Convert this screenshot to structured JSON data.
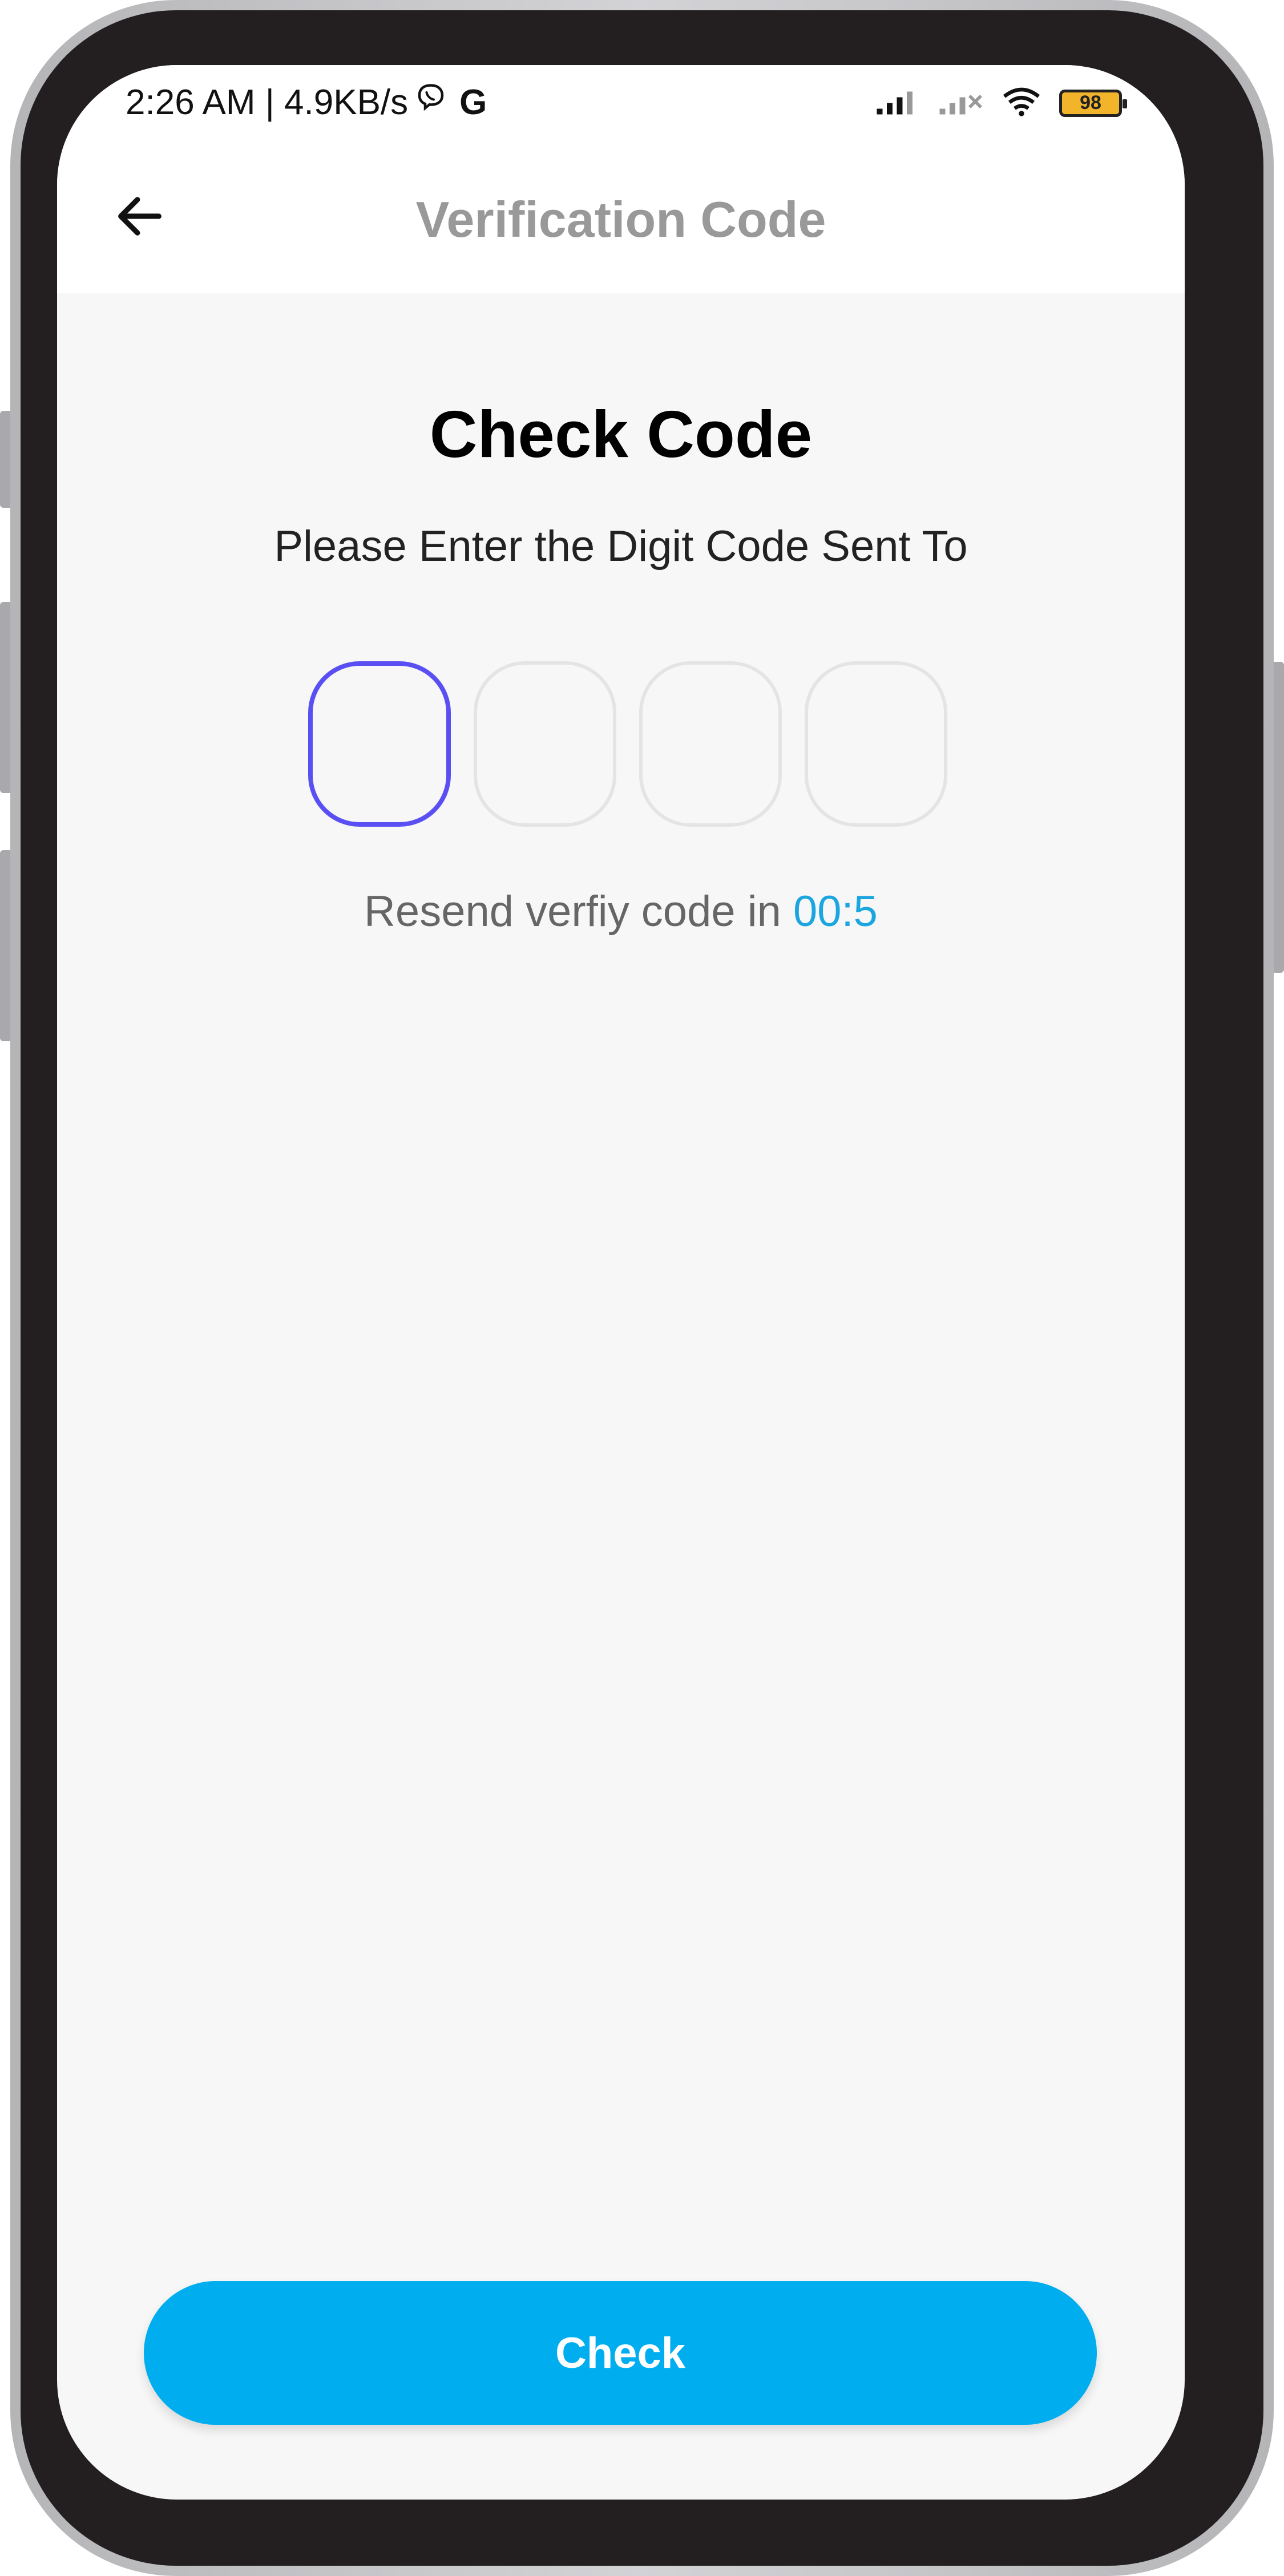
{
  "status_bar": {
    "time_and_speed": "2:26 AM | 4.9KB/s",
    "g_label": "G",
    "battery_level": "98"
  },
  "app_bar": {
    "title": "Verification Code",
    "back_icon": "arrow-left-icon"
  },
  "content": {
    "heading": "Check Code",
    "subheading": "Please Enter the Digit Code Sent To",
    "otp_digits": [
      "",
      "",
      "",
      ""
    ],
    "resend_text": "Resend verfiy code in",
    "timer": "00:5"
  },
  "actions": {
    "check_label": "Check"
  },
  "colors": {
    "accent": "#00aef0",
    "active_box_border": "#5a4ff2",
    "timer_color": "#1ba6e0",
    "screen_background": "#f7f7f7"
  }
}
